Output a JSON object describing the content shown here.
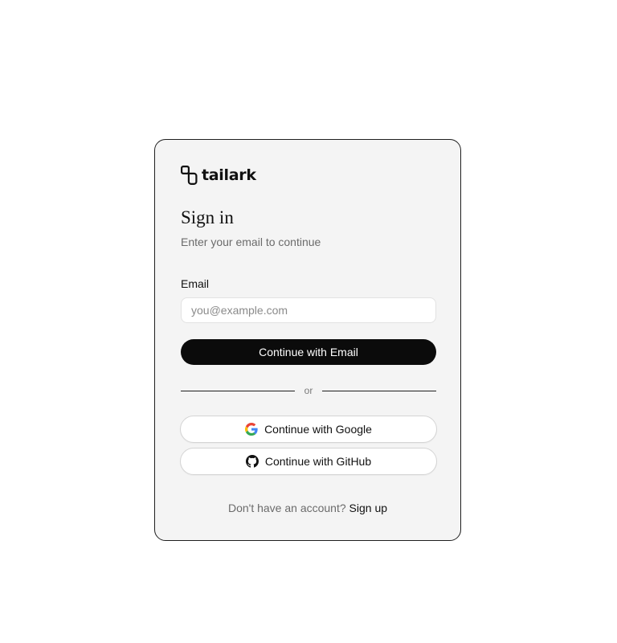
{
  "brand": {
    "name": "tailark",
    "logo_icon": "tailark-logo-icon"
  },
  "heading": {
    "title": "Sign in",
    "subtitle": "Enter your email to continue"
  },
  "form": {
    "email_label": "Email",
    "email_value": "",
    "email_placeholder": "you@example.com",
    "submit_label": "Continue with Email"
  },
  "divider": {
    "text": "or"
  },
  "social": {
    "google_label": "Continue with Google",
    "google_icon": "google-icon",
    "github_label": "Continue with GitHub",
    "github_icon": "github-icon"
  },
  "footer": {
    "prompt": "Don't have an account?",
    "signup_label": "Sign up"
  },
  "colors": {
    "page_background": "#ffffff",
    "card_background": "#f4f4f4",
    "primary_button": "#0b0b0b",
    "muted_text": "#6b6b6b"
  }
}
